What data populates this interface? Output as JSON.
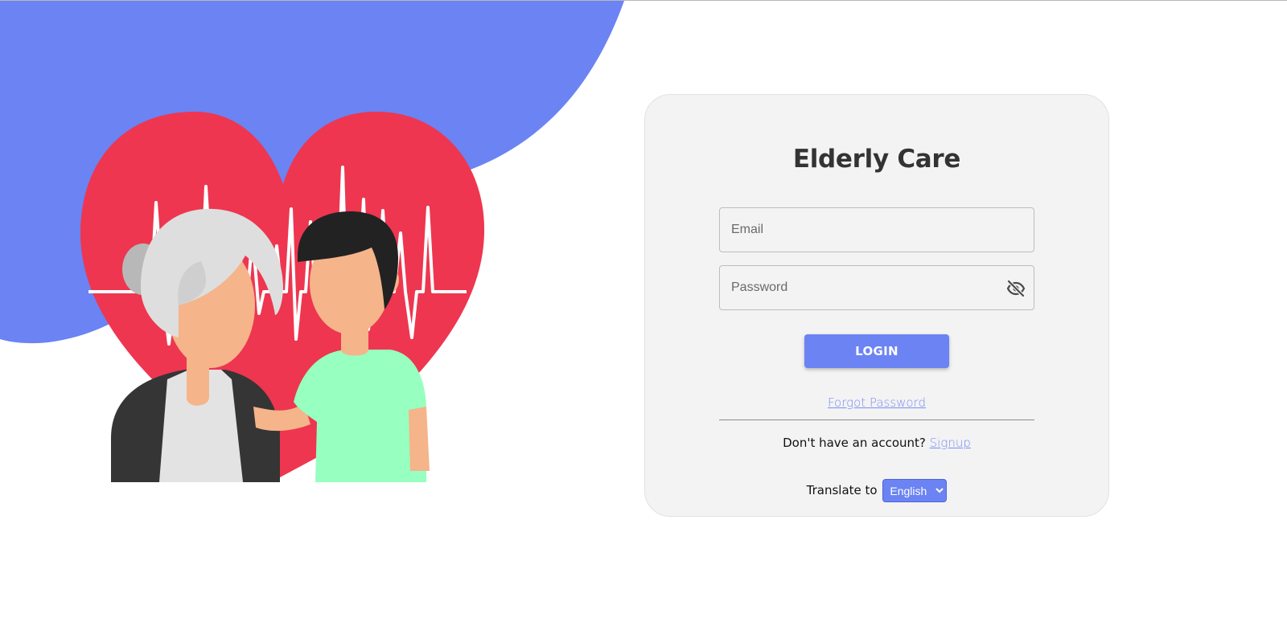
{
  "app": {
    "title": "Elderly Care"
  },
  "login_form": {
    "email_placeholder": "Email",
    "email_value": "",
    "password_placeholder": "Password",
    "password_value": "",
    "password_toggle_icon": "eye-slash-icon",
    "login_label": "LOGIN",
    "forgot_password_label": "Forgot Password",
    "no_account_text": "Don't have an account?",
    "signup_label": "Signup"
  },
  "translate": {
    "label": "Translate to",
    "selected_language": "English"
  },
  "colors": {
    "accent": "#6b83f3",
    "heart": "#ee3650",
    "card_background": "#f3f3f3",
    "title_text": "#333333"
  }
}
